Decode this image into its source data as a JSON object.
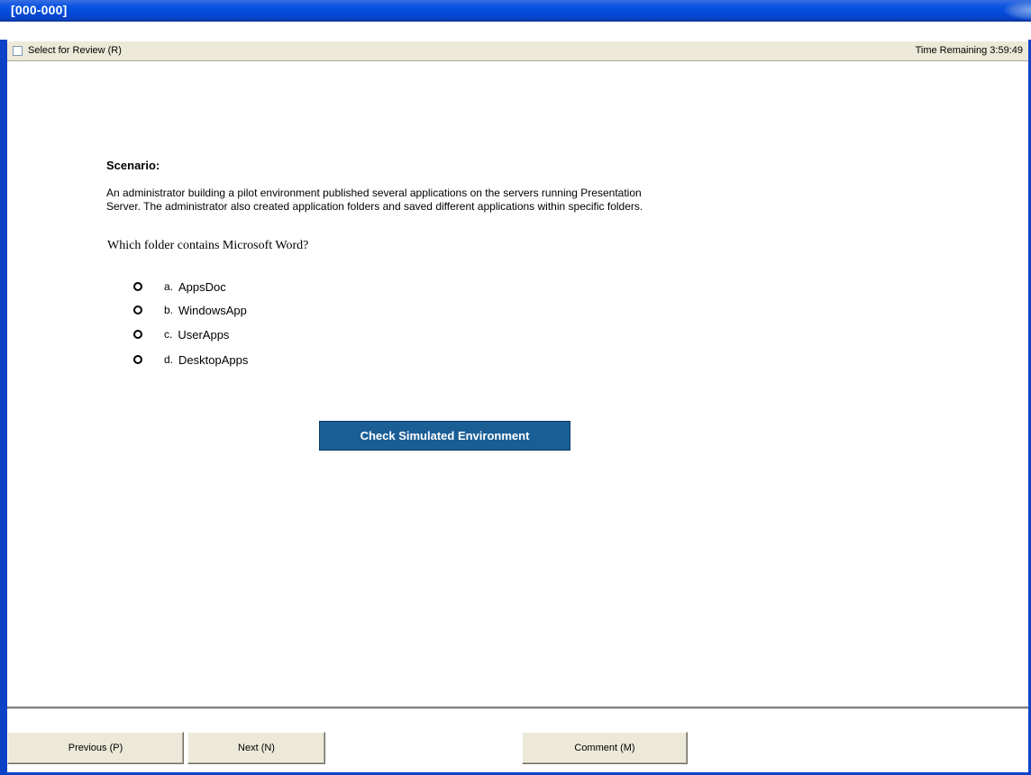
{
  "window": {
    "title": "[000-000]"
  },
  "review": {
    "label": "Select for Review (R)",
    "checked": false
  },
  "timer": {
    "text": "Time Remaining 3:59:49"
  },
  "scenario": {
    "heading": "Scenario:",
    "line1": "An administrator building a pilot environment published several applications on the servers running Presentation",
    "line2": "Server. The administrator also created application folders and saved different applications within specific folders."
  },
  "question": {
    "text": "Which folder contains Microsoft Word?"
  },
  "options": [
    {
      "letter": "a.",
      "text": "AppsDoc"
    },
    {
      "letter": "b.",
      "text": "WindowsApp"
    },
    {
      "letter": "c.",
      "text": "UserApps"
    },
    {
      "letter": "d.",
      "text": "DesktopApps"
    }
  ],
  "simulation": {
    "button_label": "Check Simulated Environment"
  },
  "footer": {
    "previous_label": "Previous (P)",
    "next_label": "Next (N)",
    "comment_label": "Comment (M)"
  },
  "colors": {
    "titlebar": "#0a55e2",
    "frame": "#0b42c6",
    "panel": "#ece9d8",
    "primary_button": "#1a5e96"
  }
}
